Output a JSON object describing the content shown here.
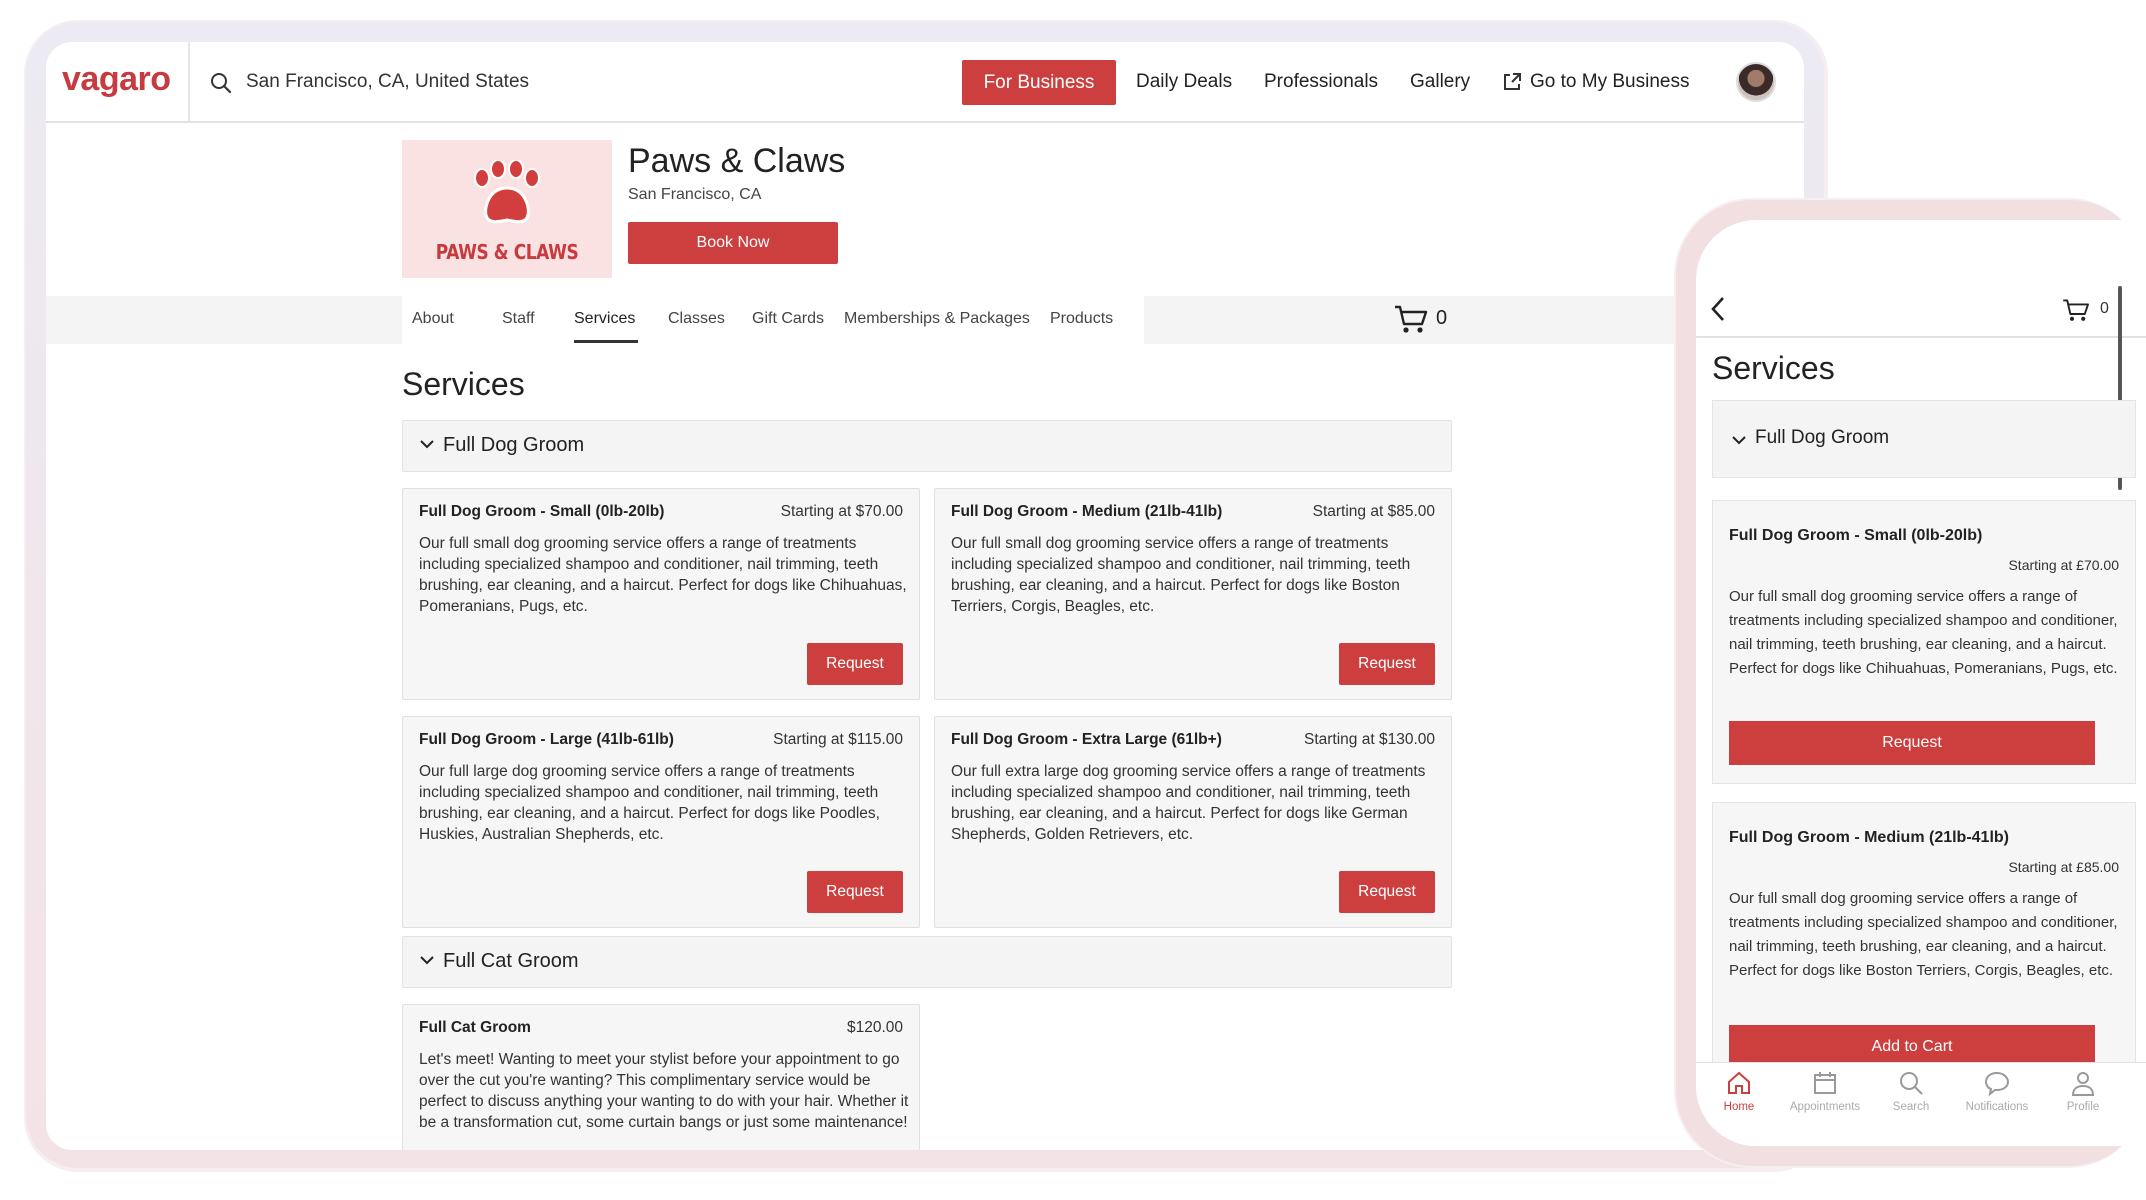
{
  "desktop": {
    "logo": "vagaro",
    "search_location": "San Francisco, CA, United States",
    "nav": {
      "for_business": "For Business",
      "daily_deals": "Daily Deals",
      "professionals": "Professionals",
      "gallery": "Gallery",
      "go_to_my_business": "Go to My Business"
    },
    "business": {
      "logo_text": "PAWS & CLAWS",
      "name": "Paws & Claws",
      "location": "San Francisco, CA",
      "book_now": "Book Now"
    },
    "tabs": [
      "About",
      "Staff",
      "Services",
      "Classes",
      "Gift Cards",
      "Memberships & Packages",
      "Products"
    ],
    "active_tab": "Services",
    "cart_count": "0",
    "services_title": "Services",
    "groups": [
      {
        "label": "Full Dog Groom",
        "services": [
          {
            "title": "Full Dog Groom - Small (0lb-20lb)",
            "price": "Starting at $70.00",
            "desc": "Our full small dog grooming service offers a range of treatments including specialized shampoo and conditioner, nail trimming, teeth brushing, ear cleaning, and a haircut. Perfect for dogs like Chihuahuas, Pomeranians, Pugs, etc.",
            "button": "Request"
          },
          {
            "title": "Full Dog Groom - Medium (21lb-41lb)",
            "price": "Starting at $85.00",
            "desc": "Our full small dog grooming service offers a range of treatments including specialized shampoo and conditioner, nail trimming, teeth brushing, ear cleaning, and a haircut. Perfect for dogs like Boston Terriers, Corgis, Beagles, etc.",
            "button": "Request"
          },
          {
            "title": "Full Dog Groom - Large (41lb-61lb)",
            "price": "Starting at $115.00",
            "desc": "Our full large dog grooming service offers a range of treatments including specialized shampoo and conditioner, nail trimming, teeth brushing, ear cleaning, and a haircut. Perfect for dogs like Poodles, Huskies, Australian Shepherds, etc.",
            "button": "Request"
          },
          {
            "title": "Full Dog Groom - Extra Large (61lb+)",
            "price": "Starting at $130.00",
            "desc": "Our full extra large dog grooming service offers a range of treatments including specialized shampoo and conditioner, nail trimming, teeth brushing, ear cleaning, and a haircut. Perfect for dogs like German Shepherds, Golden Retrievers, etc.",
            "button": "Request"
          }
        ]
      },
      {
        "label": "Full Cat Groom",
        "services": [
          {
            "title": "Full Cat Groom",
            "price": "$120.00",
            "desc": "Let's meet! Wanting to meet your stylist before your appointment to go over the cut you're wanting? This complimentary service would be perfect to discuss anything your wanting to do with your hair. Whether it be a transformation cut, some curtain bangs or just some maintenance!"
          }
        ]
      }
    ]
  },
  "mobile": {
    "cart_count": "0",
    "services_title": "Services",
    "group_label": "Full Dog Groom",
    "cards": [
      {
        "title": "Full Dog Groom - Small (0lb-20lb)",
        "price": "Starting at £70.00",
        "desc": "Our full small dog grooming service offers a range of treatments including specialized shampoo and conditioner, nail trimming, teeth brushing, ear cleaning, and a haircut. Perfect for dogs like Chihuahuas, Pomeranians, Pugs, etc.",
        "button": "Request"
      },
      {
        "title": "Full Dog Groom - Medium (21lb-41lb)",
        "price": "Starting at £85.00",
        "desc": "Our full small dog grooming service offers a range of treatments including specialized shampoo and conditioner, nail trimming, teeth brushing, ear cleaning, and a haircut. Perfect for dogs like Boston Terriers, Corgis, Beagles, etc.",
        "button": "Add to Cart"
      }
    ],
    "bottom_nav": [
      {
        "label": "Home",
        "icon": "home-icon",
        "active": true
      },
      {
        "label": "Appointments",
        "icon": "calendar-icon",
        "active": false
      },
      {
        "label": "Search",
        "icon": "search-icon",
        "active": false
      },
      {
        "label": "Notifications",
        "icon": "chat-bubble-icon",
        "active": false
      },
      {
        "label": "Profile",
        "icon": "person-icon",
        "active": false
      }
    ]
  },
  "colors": {
    "brand_red": "#cd3f3f",
    "logo_bg": "#fbe2e2",
    "panel_bg": "#f4f4f4"
  }
}
